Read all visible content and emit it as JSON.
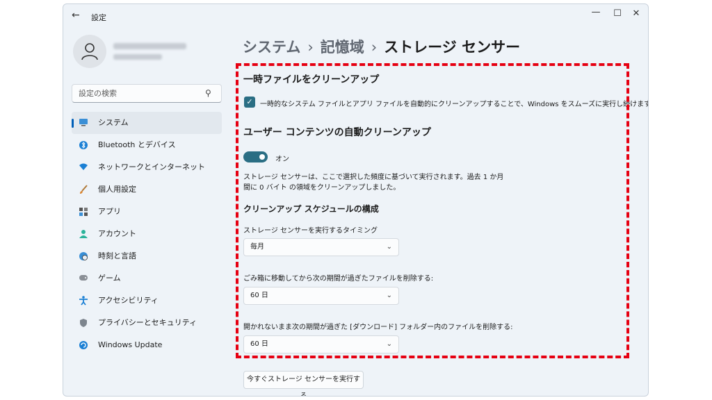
{
  "window": {
    "title": "設定",
    "back_icon": "back-arrow-icon",
    "controls": [
      "minimize-icon",
      "maximize-icon",
      "close-icon"
    ]
  },
  "sidebar": {
    "search_placeholder": "設定の検索",
    "items": [
      {
        "label": "システム",
        "icon": "monitor-icon",
        "active": true
      },
      {
        "label": "Bluetooth とデバイス",
        "icon": "bluetooth-icon"
      },
      {
        "label": "ネットワークとインターネット",
        "icon": "wifi-icon"
      },
      {
        "label": "個人用設定",
        "icon": "brush-icon"
      },
      {
        "label": "アプリ",
        "icon": "apps-icon"
      },
      {
        "label": "アカウント",
        "icon": "person-icon"
      },
      {
        "label": "時刻と言語",
        "icon": "globe-clock-icon"
      },
      {
        "label": "ゲーム",
        "icon": "gamepad-icon"
      },
      {
        "label": "アクセシビリティ",
        "icon": "accessibility-icon"
      },
      {
        "label": "プライバシーとセキュリティ",
        "icon": "shield-icon"
      },
      {
        "label": "Windows Update",
        "icon": "update-icon"
      }
    ]
  },
  "breadcrumb": {
    "items": [
      "システム",
      "記憶域",
      "ストレージ センサー"
    ],
    "separator": "›"
  },
  "temp_files": {
    "heading": "一時ファイルをクリーンアップ",
    "checkbox_label": "一時的なシステム ファイルとアプリ ファイルを自動的にクリーンアップすることで、Windows をスムーズに実行し続けます",
    "checked": true
  },
  "auto_cleanup": {
    "heading": "ユーザー コンテンツの自動クリーンアップ",
    "toggle_label": "オン",
    "toggle_on": true,
    "desc_line1": "ストレージ センサーは、ここで選択した頻度に基づいて実行されます。過去 1 か月",
    "desc_line2": "間に 0 バイト の領域をクリーンアップしました。"
  },
  "schedule": {
    "heading": "クリーンアップ スケジュールの構成",
    "run_label": "ストレージ センサーを実行するタイミング",
    "run_value": "毎月",
    "recycle_label": "ごみ箱に移動してから次の期間が過ぎたファイルを削除する:",
    "recycle_value": "60 日",
    "downloads_label": "開かれないまま次の期間が過ぎた [ダウンロード] フォルダー内のファイルを削除する:",
    "downloads_value": "60 日"
  },
  "run_now_button": "今すぐストレージ センサーを実行する",
  "colors": {
    "accent": "#2a6e84",
    "highlight": "#e60012",
    "window_bg": "#eef3f8"
  }
}
